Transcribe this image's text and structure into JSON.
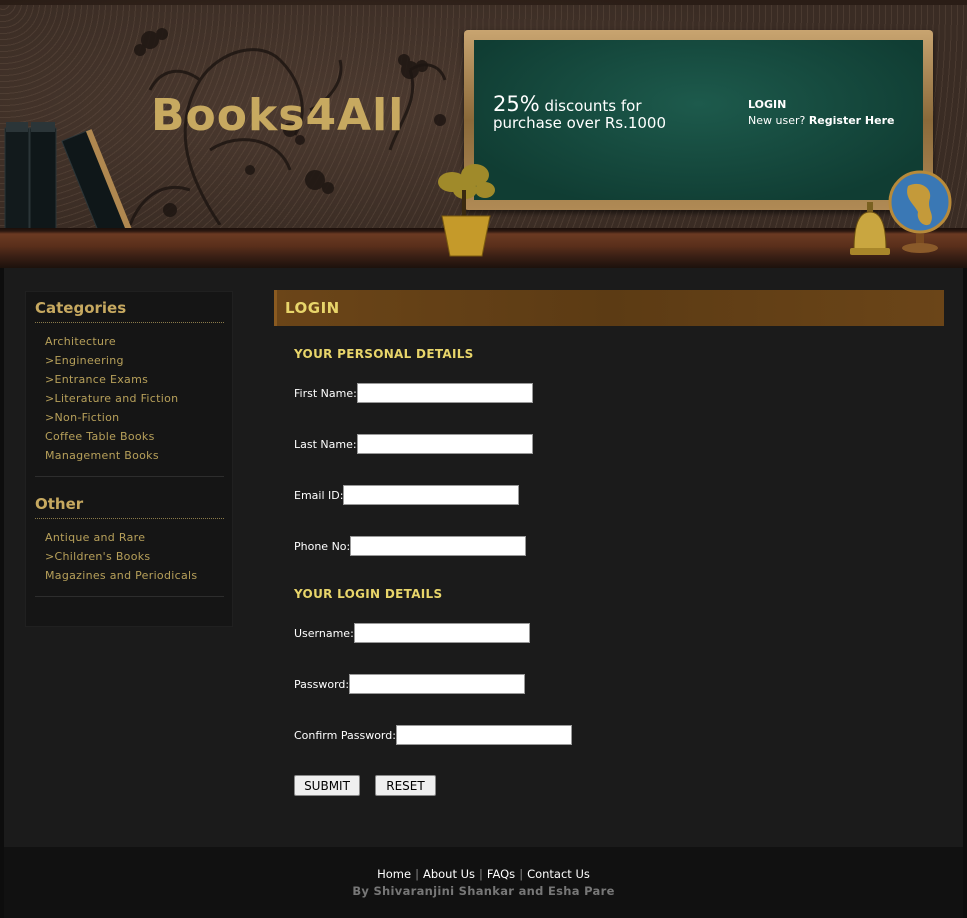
{
  "header": {
    "logo": "Books4All",
    "promo_big": "25%",
    "promo_text": " discounts for purchase over Rs.1000",
    "login_label": "LOGIN",
    "new_user_text": "New user? ",
    "register_label": "Register Here"
  },
  "sidebar": {
    "categories_title": "Categories",
    "categories": [
      "Architecture",
      ">Engineering",
      ">Entrance Exams",
      ">Literature and Fiction",
      ">Non-Fiction",
      "Coffee Table Books",
      "Management Books"
    ],
    "other_title": "Other",
    "other": [
      "Antique and Rare",
      ">Children's Books",
      "Magazines and Periodicals"
    ]
  },
  "main": {
    "title": "LOGIN",
    "personal_title": "YOUR PERSONAL DETAILS",
    "first_name_label": "First Name:",
    "last_name_label": "Last Name:",
    "email_label": "Email ID:",
    "phone_label": "Phone No:",
    "login_title": "YOUR LOGIN DETAILS",
    "username_label": "Username:",
    "password_label": "Password:",
    "confirm_label": "Confirm Password:",
    "submit_label": "SUBMIT",
    "reset_label": "RESET"
  },
  "footer": {
    "links": [
      "Home",
      "About Us",
      "FAQs",
      "Contact Us"
    ],
    "separator": "|",
    "credit": "By Shivaranjini Shankar and Esha Pare"
  }
}
